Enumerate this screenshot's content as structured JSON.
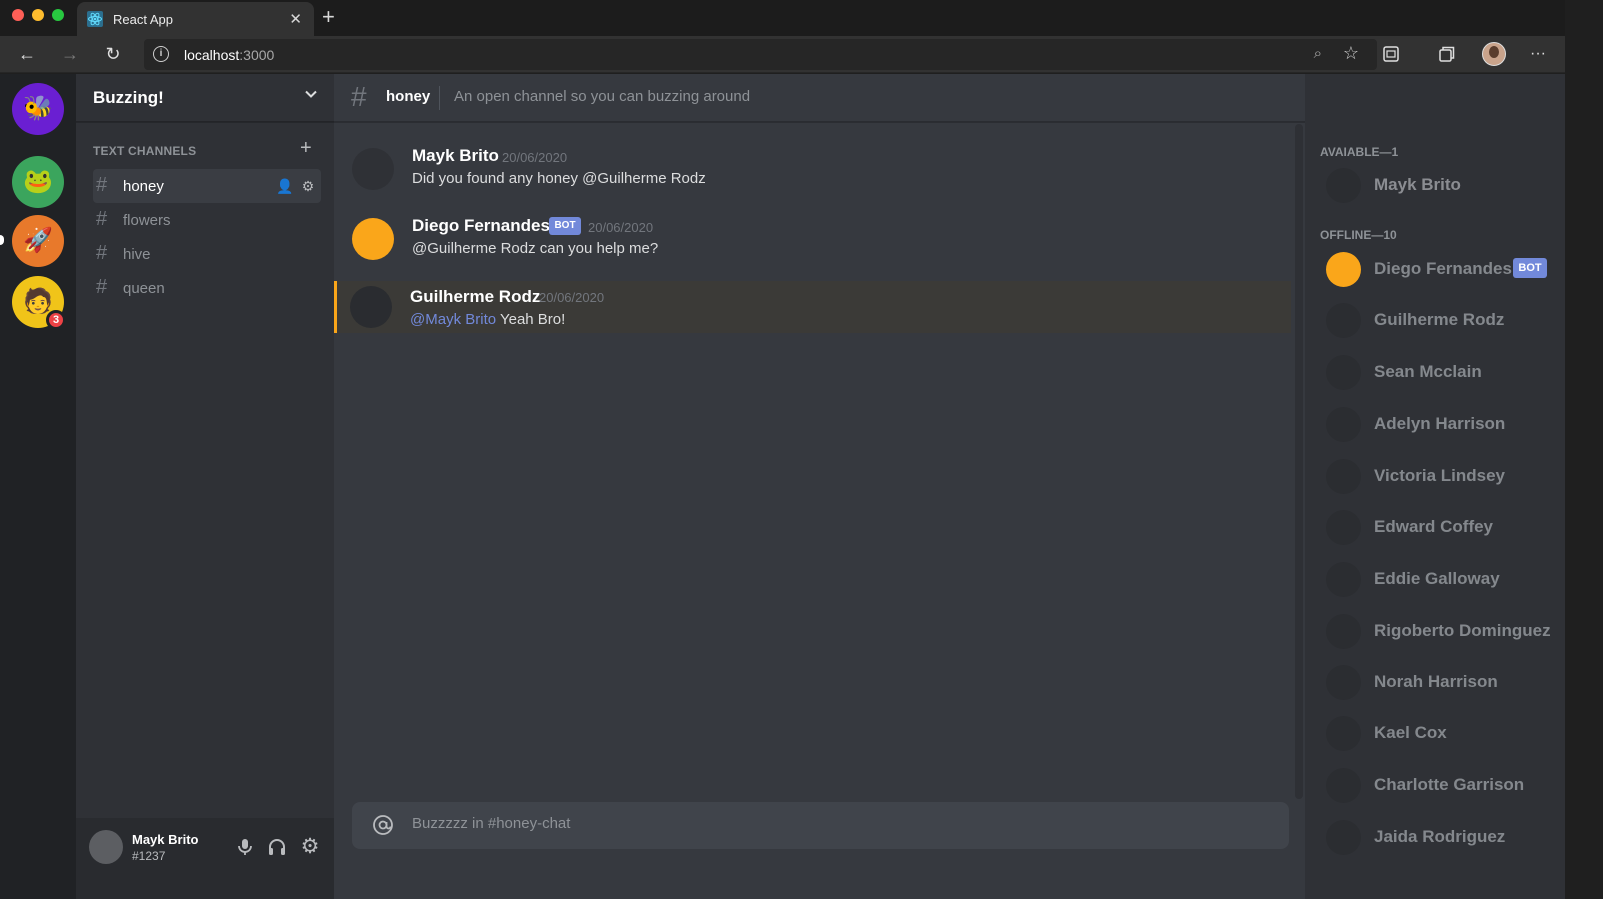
{
  "browser": {
    "tab_title": "React App",
    "address_host": "localhost",
    "address_port": ":3000",
    "icons": [
      "react-logo",
      "close",
      "plus",
      "back-arrow",
      "forward-arrow",
      "reload",
      "info",
      "zoom",
      "star",
      "collections",
      "tab-actions",
      "profile-avatar",
      "more"
    ]
  },
  "servers": {
    "items": [
      {
        "name": "bee-server",
        "color": "#6a1fd2"
      },
      {
        "name": "frog-server",
        "color": "#3ba55d"
      },
      {
        "name": "rocket-server",
        "color": "#e8792b"
      },
      {
        "name": "character-server",
        "color": "#f0c419",
        "badge": "3"
      }
    ]
  },
  "guild": {
    "name": "Buzzing!",
    "category": "TEXT CHANNELS",
    "channels": [
      {
        "label": "honey",
        "active": true
      },
      {
        "label": "flowers"
      },
      {
        "label": "hive"
      },
      {
        "label": "queen"
      }
    ]
  },
  "user": {
    "name": "Mayk Brito",
    "tag": "#1237"
  },
  "chat": {
    "channel": "honey",
    "topic": "An open channel so you can buzzing around",
    "messages": [
      {
        "author": "Mayk Brito",
        "date": "20/06/2020",
        "text": "Did you found any honey @Guilherme Rodz",
        "avatar_color": "#2f3136"
      },
      {
        "author": "Diego Fernandes",
        "bot": "BOT",
        "date": "20/06/2020",
        "text": "@Guilherme Rodz can you help me?",
        "avatar_color": "#faa61a"
      },
      {
        "author": "Guilherme Rodz",
        "date": "20/06/2020",
        "mention": "@Mayk Brito",
        "text": " Yeah Bro!",
        "avatar_color": "#2f3136",
        "mentioned": true
      }
    ],
    "composer_placeholder": "Buzzzzz in #honey-chat"
  },
  "members": {
    "online_title": "AVAIABLE—1",
    "offline_title": "OFFLINE—10",
    "online": [
      {
        "name": "Mayk Brito"
      }
    ],
    "offline": [
      {
        "name": "Diego Fernandes",
        "bot": "BOT",
        "avatar_color": "#faa61a"
      },
      {
        "name": "Guilherme Rodz"
      },
      {
        "name": "Sean Mcclain"
      },
      {
        "name": "Adelyn Harrison"
      },
      {
        "name": "Victoria Lindsey"
      },
      {
        "name": "Edward Coffey"
      },
      {
        "name": "Eddie Galloway"
      },
      {
        "name": "Rigoberto Dominguez"
      },
      {
        "name": "Norah Harrison"
      },
      {
        "name": "Kael Cox"
      },
      {
        "name": "Charlotte Garrison"
      },
      {
        "name": "Jaida Rodriguez"
      }
    ]
  },
  "colors": {
    "accent": "#7289da",
    "mention_highlight": "#faa61a",
    "background": "#36393f"
  }
}
